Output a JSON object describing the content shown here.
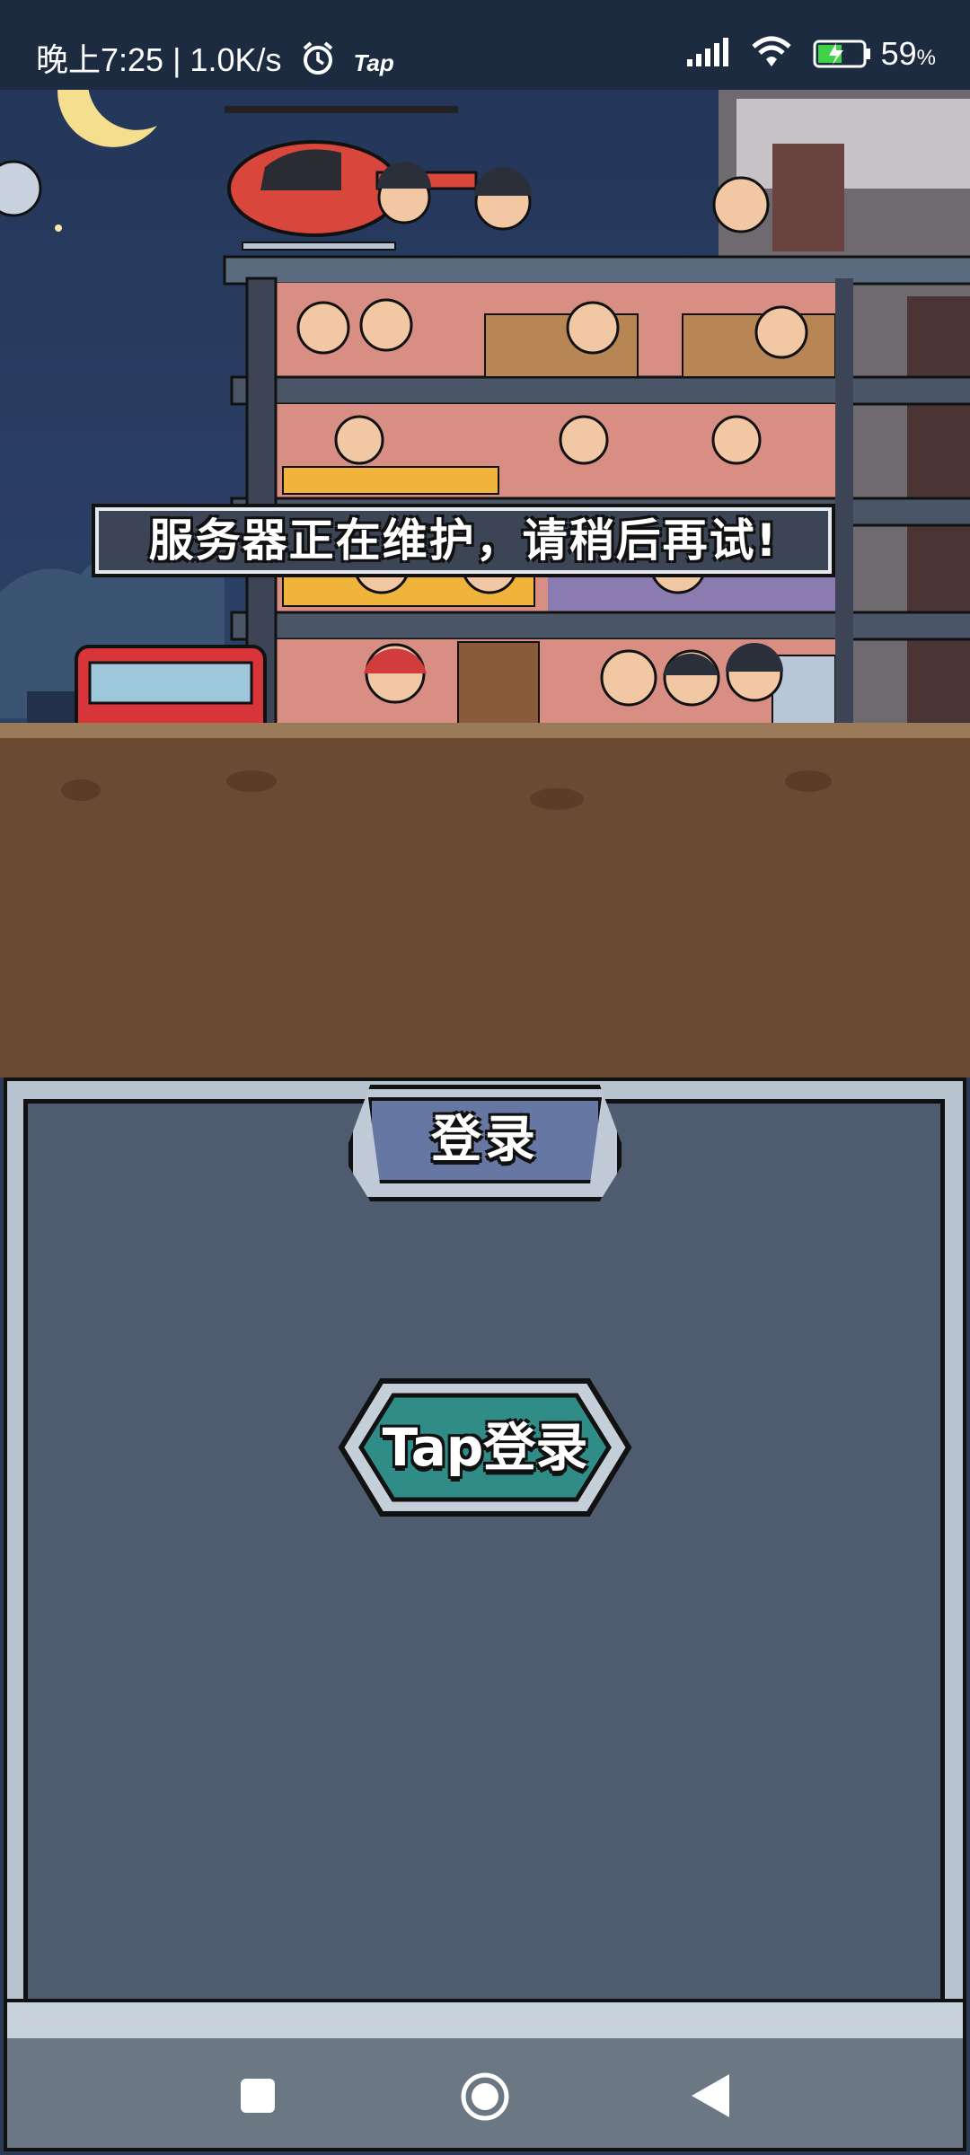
{
  "status_bar": {
    "time_speed": "晚上7:25 | 1.0K/s",
    "tap_badge": "Tap",
    "battery": "59",
    "icons": [
      "alarm-icon",
      "signal-icon",
      "wifi-icon",
      "battery-icon"
    ]
  },
  "notice": {
    "text": "服务器正在维护，请稍后再试!"
  },
  "login_panel": {
    "title": "登录",
    "tap_login_label": "Tap登录"
  },
  "nav": {
    "icons": [
      "recent-apps-icon",
      "home-icon",
      "back-icon"
    ]
  },
  "colors": {
    "panel_bg": "#4f5c70",
    "button_teal": "#2f8c87",
    "tab_blue": "#6777a3"
  }
}
